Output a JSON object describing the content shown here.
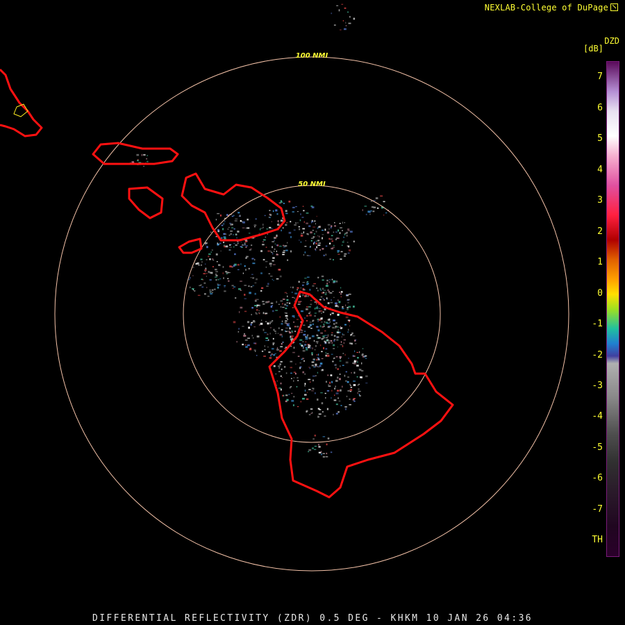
{
  "header": {
    "credit": "NEXLAB-College of DuPage"
  },
  "legend": {
    "product": "DZD",
    "units": "[dB]",
    "ticks": [
      "7",
      "6",
      "5",
      "4",
      "3",
      "2",
      "1",
      "0",
      "-1",
      "-2",
      "-3",
      "-4",
      "-5",
      "-6",
      "-7",
      "TH"
    ]
  },
  "range_rings": [
    {
      "label": "100 NMI"
    },
    {
      "label": "50 NMI"
    }
  ],
  "caption": "DIFFERENTIAL REFLECTIVITY (ZDR) 0.5 DEG - KHKM 10 JAN 26 04:36",
  "colors": {
    "background": "#000000",
    "coastline": "#ff1111",
    "range_ring": "#f4c2a8",
    "label_text": "#ffff33",
    "caption_text": "#e8e8e8"
  }
}
